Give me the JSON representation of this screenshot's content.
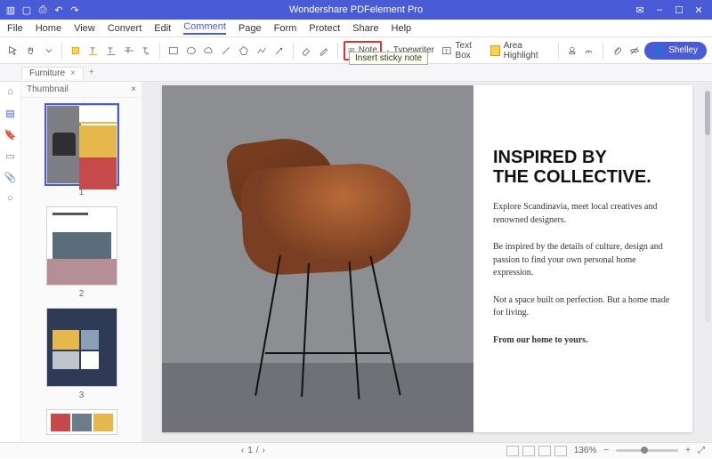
{
  "app": {
    "title": "Wondershare PDFelement Pro"
  },
  "window_controls": {
    "mail": "✉",
    "min": "–",
    "max": "☐",
    "close": "✕"
  },
  "menubar": {
    "items": [
      "File",
      "Home",
      "View",
      "Convert",
      "Edit",
      "Comment",
      "Page",
      "Form",
      "Protect",
      "Share",
      "Help"
    ],
    "active_index": 5
  },
  "toolbar": {
    "note_label": "Note",
    "typewriter_label": "Typewriter",
    "textbox_label": "Text Box",
    "area_highlight_label": "Area Highlight",
    "user_label": "Shelley"
  },
  "tooltip": {
    "note": "Insert sticky note"
  },
  "tab": {
    "name": "Furniture"
  },
  "thumbnail_panel": {
    "title": "Thumbnail",
    "pages": [
      "1",
      "2",
      "3"
    ]
  },
  "document": {
    "heading_line1": "INSPIRED BY",
    "heading_line2": "THE COLLECTIVE.",
    "p1": "Explore Scandinavia, meet local creatives and renowned designers.",
    "p2": "Be inspired by the details of culture, design and passion to find your own personal home expression.",
    "p3": "Not a space built on perfection. But a home made for living.",
    "p4": "From our home to yours."
  },
  "statusbar": {
    "page_current": "1",
    "page_sep": "/",
    "zoom": "136%"
  },
  "icons": {
    "home": "⌂",
    "bookmark": "☐",
    "bookmark2": "▭",
    "attach": "📎",
    "comment": "○",
    "close_small": "×",
    "add": "+",
    "prev": "‹",
    "next": "›",
    "fit": "⤢",
    "user": "👤"
  },
  "colors": {
    "accent": "#4a5bd6",
    "highlight_border": "#e03030"
  }
}
